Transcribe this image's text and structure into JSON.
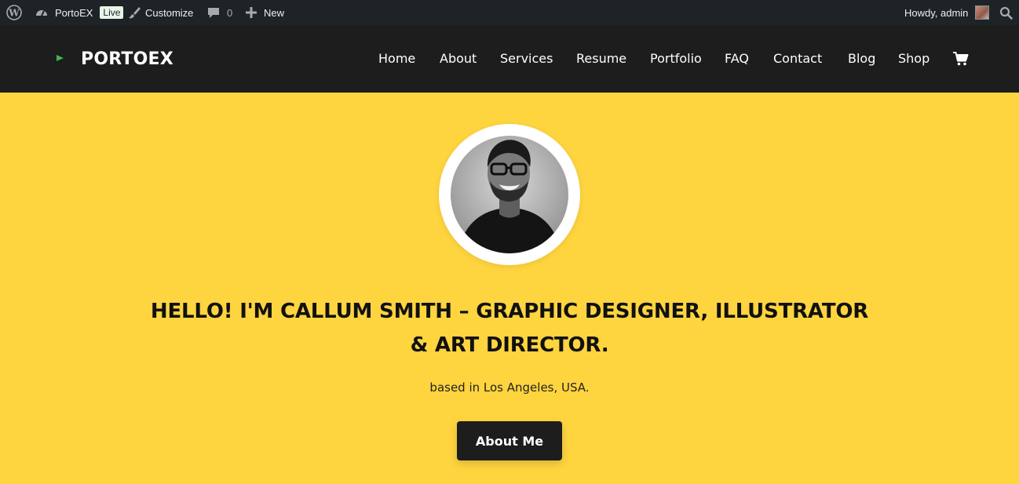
{
  "admin_bar": {
    "site_name": "PortoEX",
    "live_badge": "Live",
    "customize_label": "Customize",
    "comments_count": "0",
    "new_label": "New",
    "greeting": "Howdy, admin",
    "icons": [
      "wordpress-icon",
      "dashboard-icon",
      "brush-icon",
      "comment-icon",
      "plus-icon",
      "search-icon"
    ]
  },
  "header": {
    "logo": "PORTOEX",
    "nav": [
      "Home",
      "About",
      "Services",
      "Resume",
      "Portfolio",
      "FAQ",
      "Contact",
      "Blog",
      "Shop"
    ],
    "cart_icon": "cart-icon"
  },
  "hero": {
    "headline_line1": "HELLO! I'M CALLUM SMITH – GRAPHIC DESIGNER, ILLUSTRATOR",
    "headline_line2": "& ART DIRECTOR.",
    "subtext": "based in Los Angeles, USA.",
    "button_label": "About Me"
  },
  "colors": {
    "admin_bar_bg": "#1d2327",
    "header_bg": "#1d1d1d",
    "hero_bg": "#fed43f",
    "logo_accent": "#3fb84f",
    "button_bg": "#1d1d1d"
  }
}
